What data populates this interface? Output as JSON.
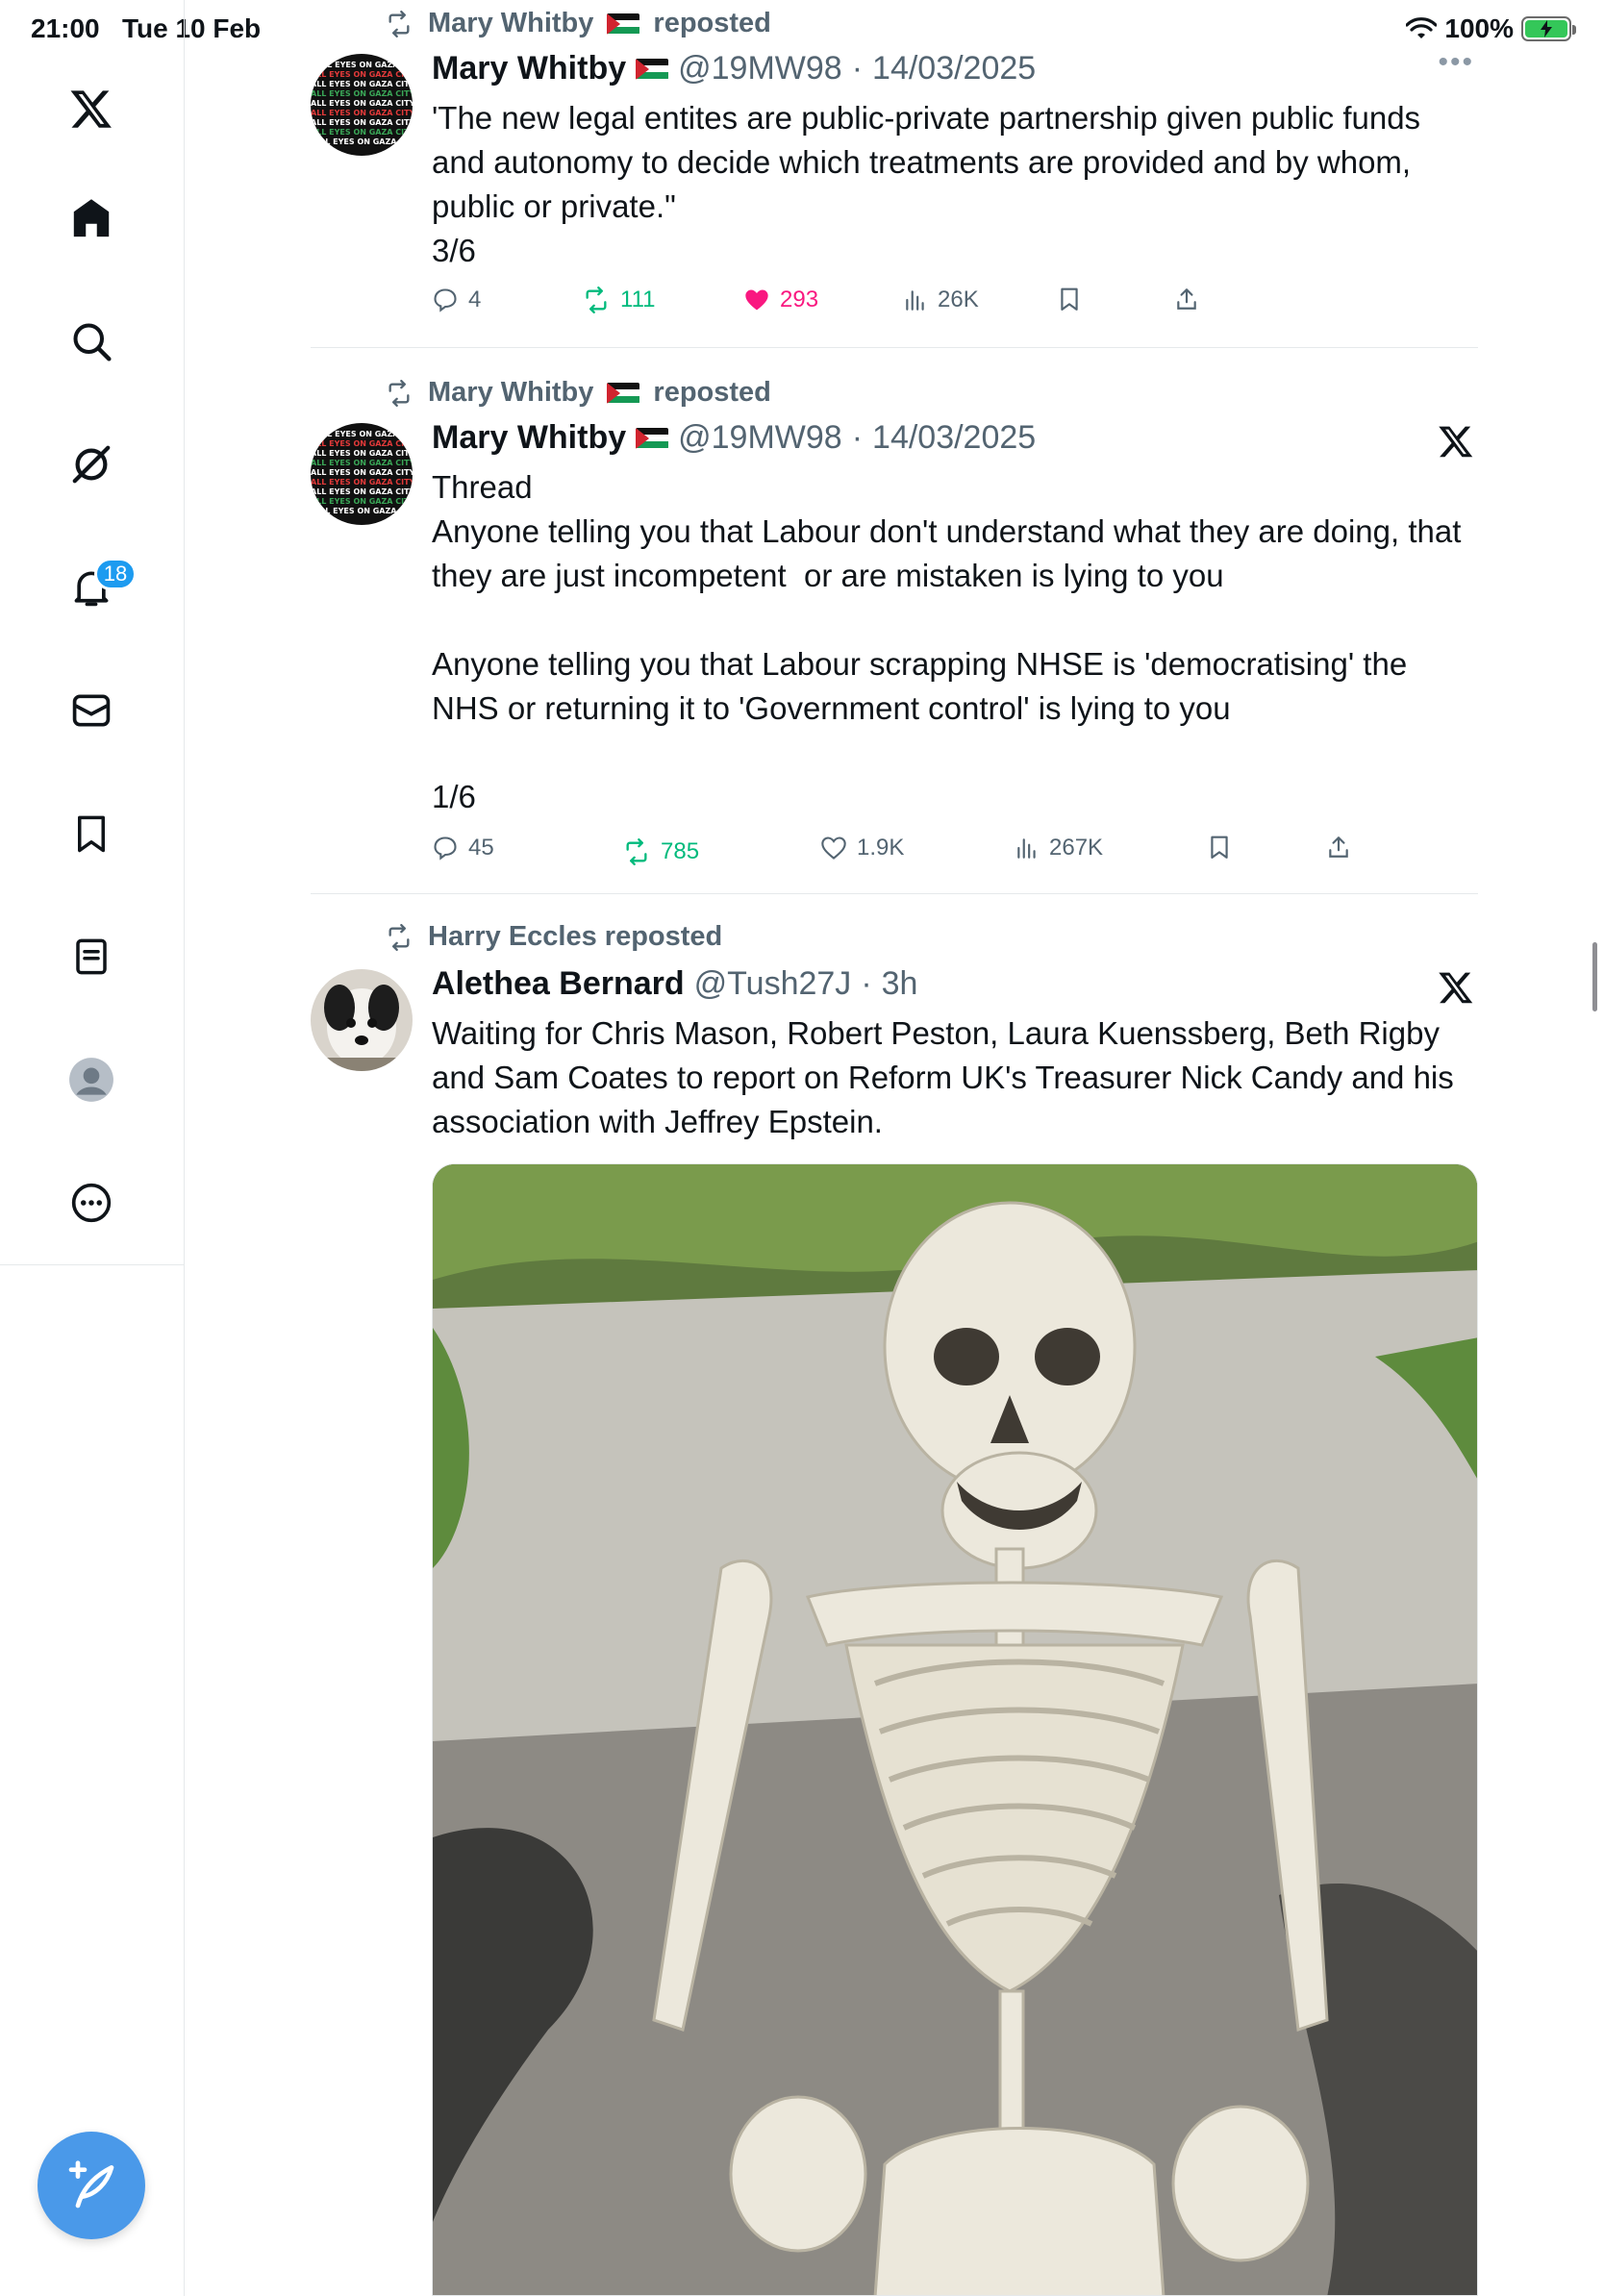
{
  "status_bar": {
    "time": "21:00",
    "date": "Tue 10 Feb",
    "battery": "100%"
  },
  "sidebar": {
    "items": [
      {
        "name": "x-logo-icon"
      },
      {
        "name": "home-icon"
      },
      {
        "name": "search-icon"
      },
      {
        "name": "grok-icon"
      },
      {
        "name": "notifications-icon"
      },
      {
        "name": "messages-icon"
      },
      {
        "name": "bookmarks-icon"
      },
      {
        "name": "lists-icon"
      },
      {
        "name": "profile-icon"
      },
      {
        "name": "more-icon"
      }
    ],
    "notification_count": "18",
    "compose_icon": "compose-icon"
  },
  "posts": [
    {
      "reposted_by": "Mary Whitby 🇵🇸 reposted",
      "reposted_by_name": "Mary Whitby",
      "reposted_suffix": "reposted",
      "author_name": "Mary Whitby",
      "handle": "@19MW98",
      "separator": "·",
      "date": "14/03/2025",
      "text": "'The new legal entites are public-private partnership given public funds and autonomy to decide which treatments are provided and by whom, public or private.\"\n3/6",
      "replies": "4",
      "reposts": "111",
      "likes": "293",
      "views": "26K",
      "liked": true
    },
    {
      "reposted_by_name": "Mary Whitby",
      "reposted_suffix": "reposted",
      "author_name": "Mary Whitby",
      "handle": "@19MW98",
      "separator": "·",
      "date": "14/03/2025",
      "text": "Thread\nAnyone telling you that Labour don't understand what they are doing, that they are just incompetent  or are mistaken is lying to you\n\nAnyone telling you that Labour scrapping NHSE is 'democratising' the NHS or returning it to 'Government control' is lying to you\n\n1/6",
      "replies": "45",
      "reposts": "785",
      "likes": "1.9K",
      "views": "267K",
      "reposted": true
    },
    {
      "reposted_by": "Harry Eccles reposted",
      "author_name": "Alethea Bernard",
      "handle": "@Tush27J",
      "separator": "·",
      "date": "3h",
      "text": "Waiting for Chris Mason, Robert Peston, Laura Kuenssberg, Beth Rigby and Sam Coates to report on Reform UK's Treasurer Nick Candy and his association with Jeffrey Epstein."
    }
  ],
  "colors": {
    "accent": "#1d9bf0",
    "like": "#f91880",
    "repost": "#00ba7c",
    "muted": "#536471",
    "compose": "#4a99e9"
  }
}
